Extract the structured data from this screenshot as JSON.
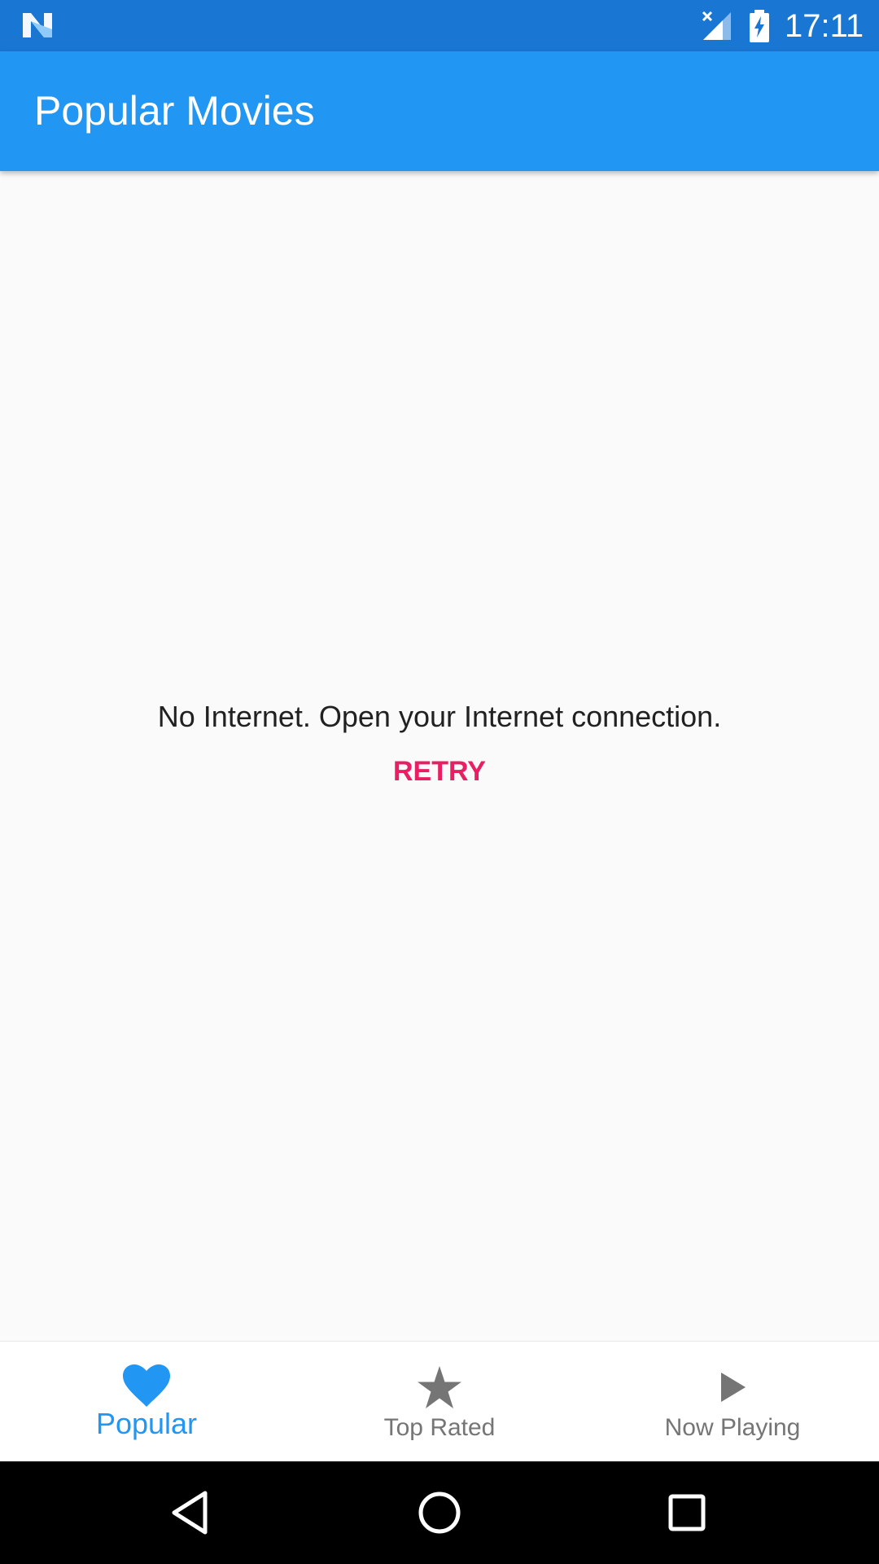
{
  "status_bar": {
    "time": "17:11",
    "icons": [
      "n-logo-icon",
      "signal-no-data-icon",
      "battery-charging-icon"
    ]
  },
  "app_bar": {
    "title": "Popular Movies"
  },
  "content": {
    "message": "No Internet. Open your Internet connection.",
    "retry_label": "RETRY"
  },
  "bottom_nav": {
    "items": [
      {
        "label": "Popular",
        "icon": "heart-icon",
        "active": true
      },
      {
        "label": "Top Rated",
        "icon": "star-icon",
        "active": false
      },
      {
        "label": "Now Playing",
        "icon": "play-icon",
        "active": false
      }
    ]
  },
  "system_nav": {
    "buttons": [
      "back-icon",
      "home-icon",
      "recents-icon"
    ]
  },
  "colors": {
    "status_bar": "#1976d2",
    "primary": "#2196f3",
    "accent": "#e91e63",
    "inactive": "#757575",
    "background": "#fafafa"
  }
}
